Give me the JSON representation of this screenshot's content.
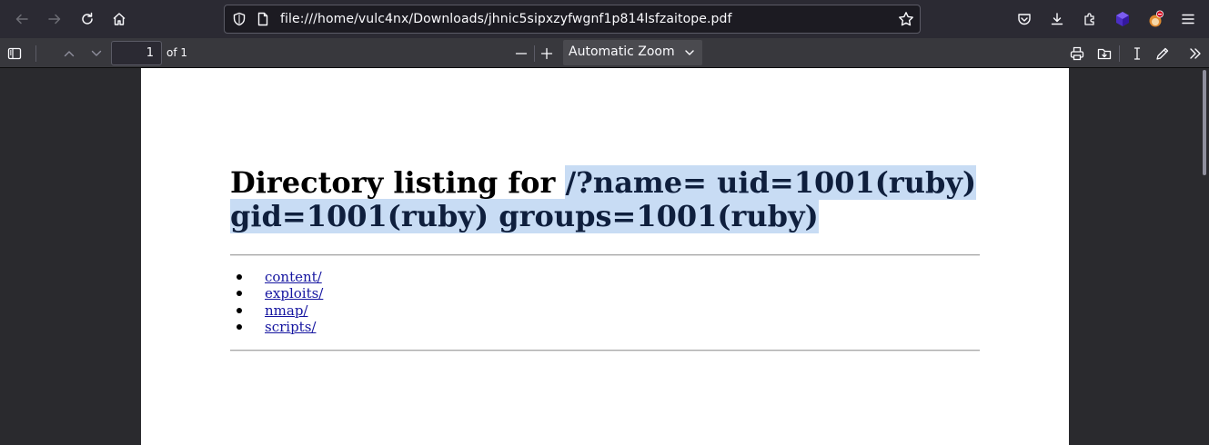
{
  "browser": {
    "url": "file:///home/vulc4nx/Downloads/jhnic5sipxzyfwgnf1p814lsfzaitope.pdf"
  },
  "pdf_toolbar": {
    "page_number": "1",
    "page_count_label": "of 1",
    "zoom_label": "Automatic Zoom"
  },
  "document": {
    "title_plain": "Directory listing for ",
    "title_highlighted_line1": "/?name= uid=1001(ruby)",
    "title_highlighted_line2": "gid=1001(ruby) groups=1001(ruby)",
    "entries": [
      "content/",
      "exploits/",
      "nmap/",
      "scripts/"
    ]
  },
  "colors": {
    "selection_highlight": "#c8dcf4",
    "link": "#1515a0",
    "browser_chrome": "#2b2a33",
    "pdf_toolbar": "#38383d"
  }
}
